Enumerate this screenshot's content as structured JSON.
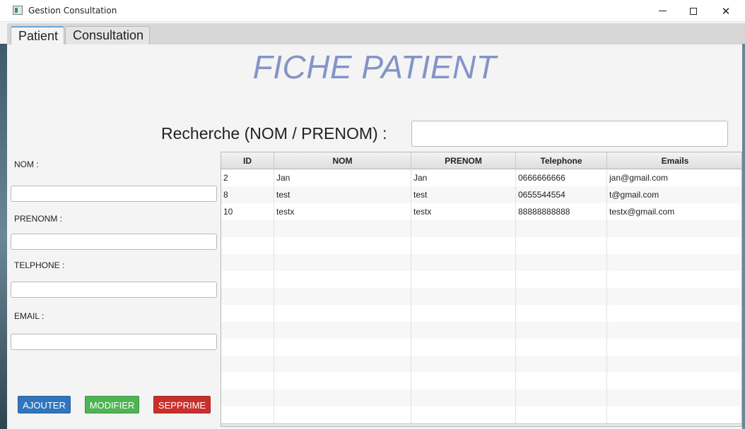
{
  "window": {
    "title": "Gestion Consultation"
  },
  "tabs": [
    {
      "label": "Patient",
      "active": true
    },
    {
      "label": "Consultation",
      "active": false
    }
  ],
  "page": {
    "title": "FICHE PATIENT"
  },
  "search": {
    "label": "Recherche (NOM / PRENOM) :",
    "value": ""
  },
  "form": {
    "nom_label": "NOM :",
    "prenom_label": "PRENONM :",
    "telephone_label": "TELPHONE :",
    "email_label": "EMAIL :",
    "nom_value": "",
    "prenom_value": "",
    "telephone_value": "",
    "email_value": ""
  },
  "buttons": {
    "add": "AJOUTER",
    "edit": "MODIFIER",
    "delete": "SEPPRIME"
  },
  "table": {
    "headers": [
      "ID",
      "NOM",
      "PRENOM",
      "Telephone",
      "Emails"
    ],
    "rows": [
      [
        "2",
        "Jan",
        "Jan",
        "0666666666",
        "jan@gmail.com"
      ],
      [
        "8",
        "test",
        "test",
        "0655544554",
        "t@gmail.com"
      ],
      [
        "10",
        "testx",
        "testx",
        "88888888888",
        "testx@gmail.com"
      ]
    ]
  },
  "colors": {
    "title": "#8494c8",
    "add_button": "#2f76be",
    "edit_button": "#4fb454",
    "delete_button": "#c9302c"
  }
}
